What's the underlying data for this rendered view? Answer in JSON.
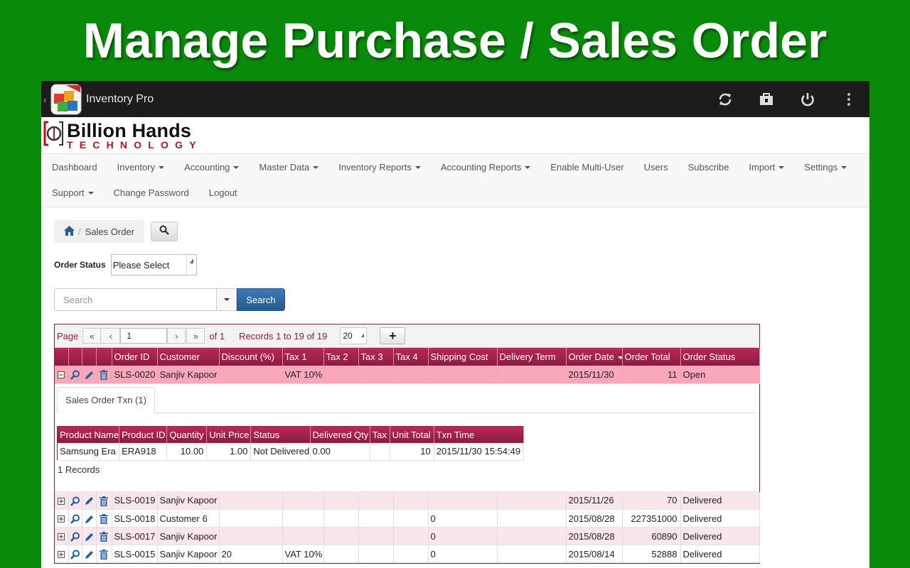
{
  "banner": {
    "title": "Manage Purchase / Sales Order"
  },
  "actionbar": {
    "app_title": "Inventory Pro",
    "icon_badge": "PRO"
  },
  "brand": {
    "name": "Billion Hands",
    "sub": "TECHNOLOGY"
  },
  "nav": {
    "row1": [
      {
        "label": "Dashboard",
        "dropdown": false
      },
      {
        "label": "Inventory",
        "dropdown": true
      },
      {
        "label": "Accounting",
        "dropdown": true
      },
      {
        "label": "Master Data",
        "dropdown": true
      },
      {
        "label": "Inventory Reports",
        "dropdown": true
      },
      {
        "label": "Accounting Reports",
        "dropdown": true
      },
      {
        "label": "Enable Multi-User",
        "dropdown": false
      },
      {
        "label": "Users",
        "dropdown": false
      },
      {
        "label": "Subscribe",
        "dropdown": false
      },
      {
        "label": "Import",
        "dropdown": true
      },
      {
        "label": "Settings",
        "dropdown": true
      }
    ],
    "row2": [
      {
        "label": "Support",
        "dropdown": true
      },
      {
        "label": "Change Password",
        "dropdown": false
      },
      {
        "label": "Logout",
        "dropdown": false
      }
    ]
  },
  "breadcrumb": {
    "separator": "/",
    "current": "Sales Order"
  },
  "filter": {
    "order_status_label": "Order Status",
    "order_status_value": "Please Select"
  },
  "search": {
    "placeholder": "Search",
    "button_label": "Search"
  },
  "pager": {
    "page_label": "Page",
    "page_value": "1",
    "of_label": "of 1",
    "records_label": "Records 1 to 19 of 19",
    "page_size": "20"
  },
  "grid": {
    "columns": [
      "Order ID",
      "Customer",
      "Discount (%)",
      "Tax 1",
      "Tax 2",
      "Tax 3",
      "Tax 4",
      "Shipping Cost",
      "Delivery Term",
      "Order Date",
      "Order Total",
      "Order Status"
    ],
    "sorted_column": "Order Date",
    "rows": [
      {
        "order_id": "SLS-0020",
        "customer": "Sanjiv Kapoor",
        "discount": "",
        "tax1": "VAT 10%",
        "tax2": "",
        "tax3": "",
        "tax4": "",
        "shipping": "",
        "delivery_term": "",
        "order_date": "2015/11/30",
        "total": "11",
        "status": "Open",
        "expanded": true
      },
      {
        "order_id": "SLS-0019",
        "customer": "Sanjiv Kapoor",
        "discount": "",
        "tax1": "",
        "tax2": "",
        "tax3": "",
        "tax4": "",
        "shipping": "",
        "delivery_term": "",
        "order_date": "2015/11/26",
        "total": "70",
        "status": "Delivered",
        "expanded": false
      },
      {
        "order_id": "SLS-0018",
        "customer": "Customer 6",
        "discount": "",
        "tax1": "",
        "tax2": "",
        "tax3": "",
        "tax4": "",
        "shipping": "0",
        "delivery_term": "",
        "order_date": "2015/08/28",
        "total": "227351000",
        "status": "Delivered",
        "expanded": false
      },
      {
        "order_id": "SLS-0017",
        "customer": "Sanjiv Kapoor",
        "discount": "",
        "tax1": "",
        "tax2": "",
        "tax3": "",
        "tax4": "",
        "shipping": "0",
        "delivery_term": "",
        "order_date": "2015/08/28",
        "total": "60890",
        "status": "Delivered",
        "expanded": false
      },
      {
        "order_id": "SLS-0015",
        "customer": "Sanjiv Kapoor",
        "discount": "20",
        "tax1": "VAT 10%",
        "tax2": "",
        "tax3": "",
        "tax4": "",
        "shipping": "0",
        "delivery_term": "",
        "order_date": "2015/08/14",
        "total": "52888",
        "status": "Delivered",
        "expanded": false
      }
    ]
  },
  "detail": {
    "tab_label": "Sales Order Txn (1)",
    "columns": [
      "Product Name",
      "Product ID",
      "Quantity",
      "Unit Price",
      "Status",
      "Delivered Qty",
      "Tax",
      "Unit Total",
      "Txn Time"
    ],
    "rows": [
      {
        "product_name": "Samsung Era",
        "product_id": "ERA918",
        "quantity": "10.00",
        "unit_price": "1.00",
        "status": "Not Delivered",
        "delivered_qty": "0.00",
        "tax": "",
        "unit_total": "10",
        "txn_time": "2015/11/30 15:54:49"
      }
    ],
    "records_label": "1 Records"
  },
  "colors": {
    "banner_green": "#0a8a0a",
    "grid_header": "#8c1c3f",
    "selected_row": "#f8a8b8",
    "alt_row": "#f8e6ea",
    "search_button": "#275a8b",
    "brand_red": "#b5121b"
  }
}
